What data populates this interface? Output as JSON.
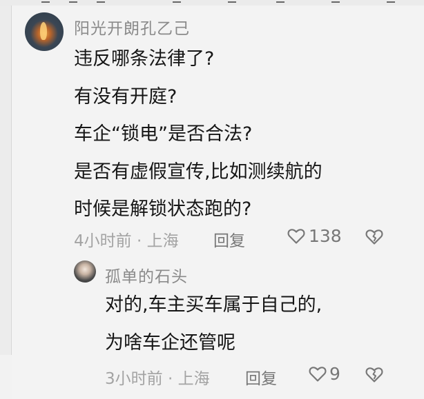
{
  "main_comment": {
    "username": "阳光开朗孔乙己",
    "lines": [
      "违反哪条法律了?",
      "有没有开庭?",
      "车企“锁电”是否合法?",
      "是否有虚假宣传,比如测续航的",
      "时候是解锁状态跑的?"
    ],
    "meta": "4小时前 · 上海",
    "reply_label": "回复",
    "like_count": "138",
    "like_icon": "heart-outline-icon",
    "dislike_icon": "broken-heart-icon"
  },
  "reply_comment": {
    "username": "孤单的石头",
    "lines": [
      "对的,车主买车属于自己的,",
      "为啥车企还管呢"
    ],
    "meta": "3小时前 · 上海",
    "reply_label": "回复",
    "like_count": "9",
    "like_icon": "heart-outline-icon",
    "dislike_icon": "broken-heart-icon"
  },
  "colors": {
    "background": "#f3f3f3",
    "text": "#161616",
    "muted": "#a3a3a3",
    "username": "#8a8a8a"
  }
}
